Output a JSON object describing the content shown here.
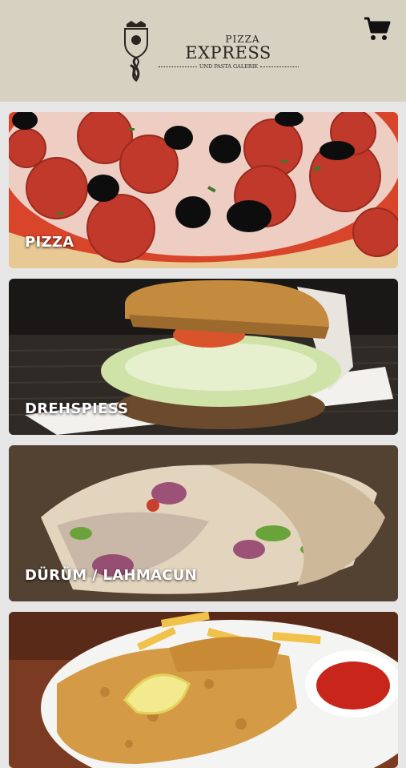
{
  "header": {
    "brand": {
      "top": "PIZZA",
      "main": "EXPRESS",
      "sub": "UND PASTA GALERIE"
    },
    "cart_icon": "shopping-cart-icon"
  },
  "categories": [
    {
      "label": "PIZZA"
    },
    {
      "label": "DREHSPIESS"
    },
    {
      "label": "DÜRÜM / LAHMACUN"
    },
    {
      "label": ""
    }
  ],
  "colors": {
    "header_bg": "#d7d1c2",
    "page_bg": "#e6e6e6",
    "text_dark": "#2a2520"
  }
}
